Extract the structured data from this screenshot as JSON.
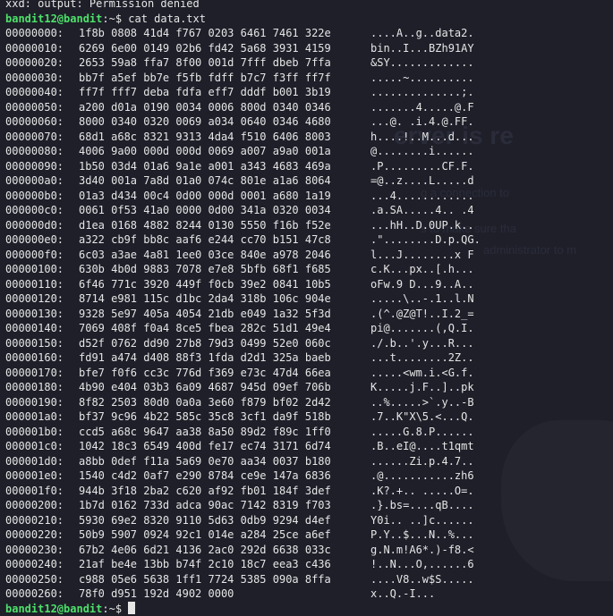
{
  "terminal": {
    "error_line": "xxd: output: Permission denied",
    "prompt_user": "bandit12@bandit",
    "prompt_suffix": ":~$ ",
    "command": "cat data.txt"
  },
  "background": {
    "title": "erver is re",
    "line1": "g a connection to",
    "line2": "s to make sure tha",
    "line3": "administrator to m"
  },
  "rows": [
    {
      "addr": "00000000:",
      "hex": "1f8b 0808 41d4 f767 0203 6461 7461 322e",
      "ascii": "....A..g..data2."
    },
    {
      "addr": "00000010:",
      "hex": "6269 6e00 0149 02b6 fd42 5a68 3931 4159",
      "ascii": "bin..I...BZh91AY"
    },
    {
      "addr": "00000020:",
      "hex": "2653 59a8 ffa7 8f00 001d 7fff dbeb 7ffa",
      "ascii": "&SY............."
    },
    {
      "addr": "00000030:",
      "hex": "bb7f a5ef bb7e f5fb fdff b7c7 f3ff ff7f",
      "ascii": ".....~.........."
    },
    {
      "addr": "00000040:",
      "hex": "ff7f fff7 deba fdfa eff7 dddf b001 3b19",
      "ascii": "..............;."
    },
    {
      "addr": "00000050:",
      "hex": "a200 d01a 0190 0034 0006 800d 0340 0346",
      "ascii": ".......4.....@.F"
    },
    {
      "addr": "00000060:",
      "hex": "8000 0340 0320 0069 a034 0640 0346 4680",
      "ascii": "...@. .i.4.@.FF."
    },
    {
      "addr": "00000070:",
      "hex": "68d1 a68c 8321 9313 4da4 f510 6406 8003",
      "ascii": "h....!..M...d..."
    },
    {
      "addr": "00000080:",
      "hex": "4006 9a00 000d 000d 0069 a007 a9a0 001a",
      "ascii": "@........i......"
    },
    {
      "addr": "00000090:",
      "hex": "1b50 03d4 01a6 9a1e a001 a343 4683 469a",
      "ascii": ".P.........CF.F."
    },
    {
      "addr": "000000a0:",
      "hex": "3d40 001a 7a8d 01a0 074c 801e a1a6 8064",
      "ascii": "=@..z....L.....d"
    },
    {
      "addr": "000000b0:",
      "hex": "01a3 d434 00c4 0d00 000d 0001 a680 1a19",
      "ascii": "...4............"
    },
    {
      "addr": "000000c0:",
      "hex": "0061 0f53 41a0 0000 0d00 341a 0320 0034",
      "ascii": ".a.SA.....4.. .4"
    },
    {
      "addr": "000000d0:",
      "hex": "d1ea 0168 4882 8244 0130 5550 f16b f52e",
      "ascii": "...hH..D.0UP.k.."
    },
    {
      "addr": "000000e0:",
      "hex": "a322 cb9f bb8c aaf6 e244 cc70 b151 47c8",
      "ascii": ".\"........D.p.QG."
    },
    {
      "addr": "000000f0:",
      "hex": "6c03 a3ae 4a81 1ee0 03ce 840e a978 2046",
      "ascii": "l...J........x F"
    },
    {
      "addr": "00000100:",
      "hex": "630b 4b0d 9883 7078 e7e8 5bfb 68f1 f685",
      "ascii": "c.K...px..[.h..."
    },
    {
      "addr": "00000110:",
      "hex": "6f46 771c 3920 449f f0cb 39e2 0841 10b5",
      "ascii": "oFw.9 D...9..A.."
    },
    {
      "addr": "00000120:",
      "hex": "8714 e981 115c d1bc 2da4 318b 106c 904e",
      "ascii": ".....\\..-.1..l.N"
    },
    {
      "addr": "00000130:",
      "hex": "9328 5e97 405a 4054 21db e049 1a32 5f3d",
      "ascii": ".(^.@Z@T!..I.2_="
    },
    {
      "addr": "00000140:",
      "hex": "7069 408f f0a4 8ce5 fbea 282c 51d1 49e4",
      "ascii": "pi@.......(,Q.I."
    },
    {
      "addr": "00000150:",
      "hex": "d52f 0762 dd90 27b8 79d3 0499 52e0 060c",
      "ascii": "./.b..'.y...R..."
    },
    {
      "addr": "00000160:",
      "hex": "fd91 a474 d408 88f3 1fda d2d1 325a baeb",
      "ascii": "...t........2Z.."
    },
    {
      "addr": "00000170:",
      "hex": "bfe7 f0f6 cc3c 776d f369 e73c 47d4 66ea",
      "ascii": ".....<wm.i.<G.f."
    },
    {
      "addr": "00000180:",
      "hex": "4b90 e404 03b3 6a09 4687 945d 09ef 706b",
      "ascii": "K.....j.F..]..pk"
    },
    {
      "addr": "00000190:",
      "hex": "8f82 2503 80d0 0a0a 3e60 f879 bf02 2d42",
      "ascii": "..%.....>`.y..-B"
    },
    {
      "addr": "000001a0:",
      "hex": "bf37 9c96 4b22 585c 35c8 3cf1 da9f 518b",
      "ascii": ".7..K\"X\\5.<...Q."
    },
    {
      "addr": "000001b0:",
      "hex": "ccd5 a68c 9647 aa38 8a50 89d2 f89c 1ff0",
      "ascii": ".....G.8.P......"
    },
    {
      "addr": "000001c0:",
      "hex": "1042 18c3 6549 400d fe17 ec74 3171 6d74",
      "ascii": ".B..eI@....t1qmt"
    },
    {
      "addr": "000001d0:",
      "hex": "a8bb 0def f11a 5a69 0e70 aa34 0037 b180",
      "ascii": "......Zi.p.4.7.."
    },
    {
      "addr": "000001e0:",
      "hex": "1540 c4d2 0af7 e290 8784 ce9e 147a 6836",
      "ascii": ".@...........zh6"
    },
    {
      "addr": "000001f0:",
      "hex": "944b 3f18 2ba2 c620 af92 fb01 184f 3def",
      "ascii": ".K?.+.. .....O=."
    },
    {
      "addr": "00000200:",
      "hex": "1b7d 0162 733d adca 90ac 7142 8319 f703",
      "ascii": ".}.bs=....qB...."
    },
    {
      "addr": "00000210:",
      "hex": "5930 69e2 8320 9110 5d63 0db9 9294 d4ef",
      "ascii": "Y0i.. ..]c......"
    },
    {
      "addr": "00000220:",
      "hex": "50b9 5907 0924 92c1 014e a284 25ce a6ef",
      "ascii": "P.Y..$...N..%..."
    },
    {
      "addr": "00000230:",
      "hex": "67b2 4e06 6d21 4136 2ac0 292d 6638 033c",
      "ascii": "g.N.m!A6*.)-f8.<"
    },
    {
      "addr": "00000240:",
      "hex": "21af be4e 13bb b74f 2c10 18c7 eea3 c436",
      "ascii": "!..N...O,......6"
    },
    {
      "addr": "00000250:",
      "hex": "c988 05e6 5638 1ff1 7724 5385 090a 8ffa",
      "ascii": "....V8..w$S....."
    },
    {
      "addr": "00000260:",
      "hex": "78f0 d951 192d 4902 0000",
      "ascii": "x..Q.-I..."
    }
  ]
}
